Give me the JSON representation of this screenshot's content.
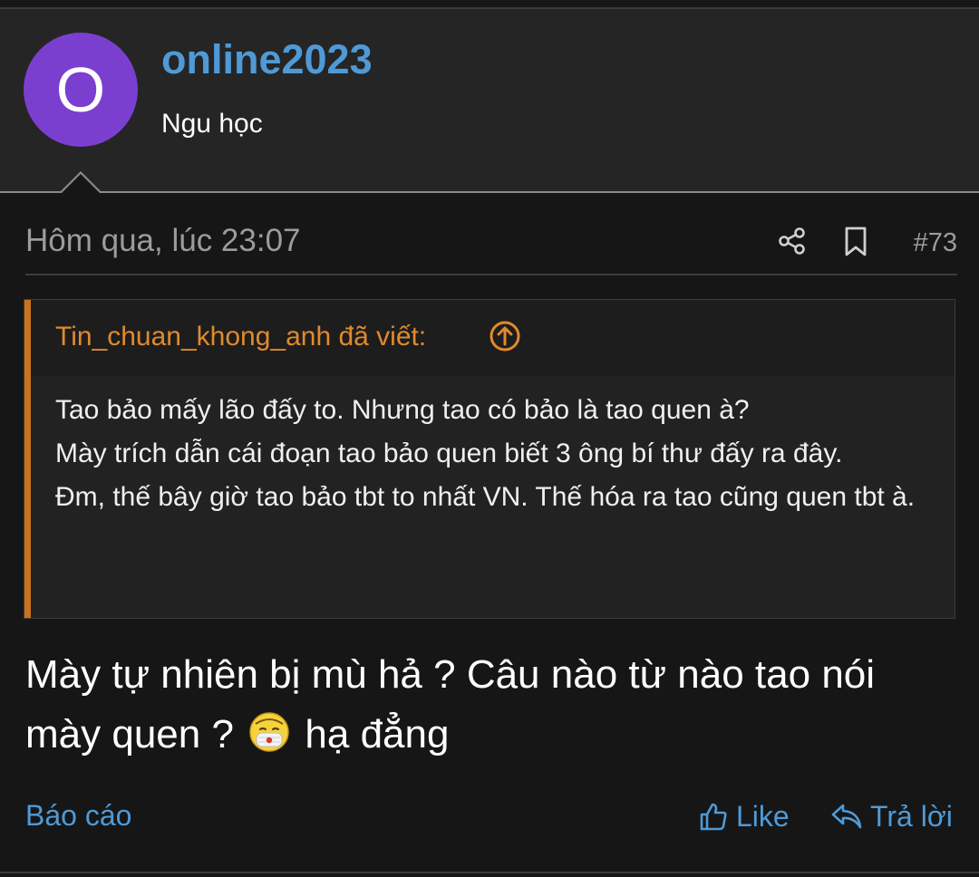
{
  "user": {
    "avatar_letter": "O",
    "avatar_color": "#7b3fd0",
    "username": "online2023",
    "title": "Ngu học"
  },
  "post": {
    "timestamp": "Hôm qua, lúc 23:07",
    "number": "#73",
    "share_icon": "share-icon",
    "bookmark_icon": "bookmark-icon"
  },
  "quote": {
    "author": "Tin_chuan_khong_anh đã viết:",
    "lines": [
      "Tao bảo mấy lão đấy to. Nhưng tao có bảo là tao quen à?",
      "Mày trích dẫn cái đoạn tao bảo quen biết 3 ông bí thư đấy ra đây.",
      "Đm, thế bây giờ tao bảo tbt to nhất VN. Thế hóa ra tao cũng quen tbt à."
    ]
  },
  "message": {
    "before_emoji": "Mày tự nhiên bị mù hả ? Câu nào từ nào tao nói mày quen ?",
    "emoji": "masked-face-emoji",
    "after_emoji": "hạ đẳng"
  },
  "actions": {
    "report": "Báo cáo",
    "like": "Like",
    "reply": "Trả lời"
  },
  "colors": {
    "background": "#161616",
    "header": "#252525",
    "link": "#4f9ad6",
    "quote_accent": "#c9741c",
    "quote_author": "#e08a2d",
    "muted": "#9c9c9c"
  }
}
